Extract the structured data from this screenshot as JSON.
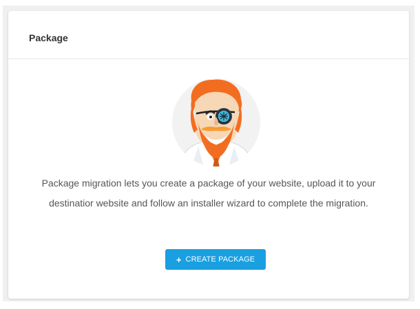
{
  "panel": {
    "title": "Package"
  },
  "hero": {
    "icon": "migration-pirate-mascot"
  },
  "description": {
    "line1": "Package migration lets you create a package of your website, upload it to your",
    "line2": "destinatior  website and follow an installer wizard to complete the migration."
  },
  "actions": {
    "create_icon": "+",
    "create_label": "CREATE PACKAGE"
  },
  "colors": {
    "accent": "#1a9fe0",
    "page_background": "#f0f0f0",
    "card_background": "#ffffff"
  }
}
